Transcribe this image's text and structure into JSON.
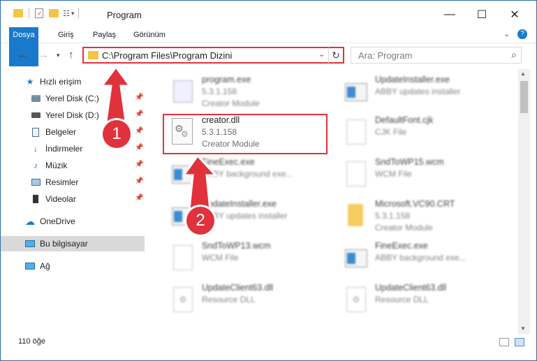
{
  "window": {
    "title": "Program",
    "controls": {
      "minimize": "—",
      "maximize": "☐",
      "close": "✕"
    }
  },
  "ribbon": {
    "tabs": [
      "Dosya",
      "Giriş",
      "Paylaş",
      "Görünüm"
    ]
  },
  "address": {
    "path": "C:\\Program Files\\Program Dizini",
    "search_placeholder": "Ara: Program"
  },
  "sidebar": {
    "items": [
      {
        "label": "Hızlı erişim",
        "icon": "star-icon"
      },
      {
        "label": "Yerel Disk (C:)",
        "icon": "drive-icon",
        "pinned": true
      },
      {
        "label": "Yerel Disk (D:)",
        "icon": "drive-icon",
        "pinned": true
      },
      {
        "label": "Belgeler",
        "icon": "documents-icon",
        "pinned": true
      },
      {
        "label": "İndirmeler",
        "icon": "download-icon",
        "pinned": true
      },
      {
        "label": "Müzik",
        "icon": "music-icon",
        "pinned": true
      },
      {
        "label": "Resimler",
        "icon": "pictures-icon",
        "pinned": true
      },
      {
        "label": "Videolar",
        "icon": "videos-icon",
        "pinned": true
      },
      {
        "label": "OneDrive",
        "icon": "cloud-icon"
      },
      {
        "label": "Bu bilgisayar",
        "icon": "computer-icon",
        "selected": true
      },
      {
        "label": "Ağ",
        "icon": "network-icon"
      }
    ]
  },
  "files": [
    {
      "name": "program.exe",
      "line2": "5.3.1.158",
      "line3": "Creator Module",
      "icon": "exe-icon"
    },
    {
      "name": "UpdateInstaller.exe",
      "line2": "ABBY updates installer",
      "line3": "",
      "icon": "window-icon"
    },
    {
      "name": "creator.dll",
      "line2": "5.3.1.158",
      "line3": "Creator Module",
      "icon": "dll-gear-icon"
    },
    {
      "name": "DefaultFont.cjk",
      "line2": "CJK File",
      "line3": "",
      "icon": "blank-file-icon"
    },
    {
      "name": "FineExec.exe",
      "line2": "ABBY background exe...",
      "line3": "",
      "icon": "window-icon"
    },
    {
      "name": "SndToWP15.wcm",
      "line2": "WCM File",
      "line3": "",
      "icon": "blank-file-icon"
    },
    {
      "name": "UpdateInstaller.exe",
      "line2": "ABBY updates installer",
      "line3": "",
      "icon": "window-icon"
    },
    {
      "name": "Microsoft.VC90.CRT",
      "line2": "5.3.1.158",
      "line3": "Creator Module",
      "icon": "folder-icon"
    },
    {
      "name": "SndToWP13.wcm",
      "line2": "WCM File",
      "line3": "",
      "icon": "blank-file-icon"
    },
    {
      "name": "FineExec.exe",
      "line2": "ABBY background exe...",
      "line3": "",
      "icon": "window-icon"
    },
    {
      "name": "UpdateClient63.dll",
      "line2": "Resource DLL",
      "line3": "",
      "icon": "dll-gear-icon"
    },
    {
      "name": "UpdateClient63.dll",
      "line2": "Resource DLL",
      "line3": "",
      "icon": "dll-gear-icon"
    }
  ],
  "status": {
    "item_count": "110 öğe"
  },
  "annotations": {
    "step1": "1",
    "step2": "2"
  },
  "colors": {
    "accent": "#1979ca",
    "highlight": "#e0323c",
    "folder": "#f3c545"
  }
}
